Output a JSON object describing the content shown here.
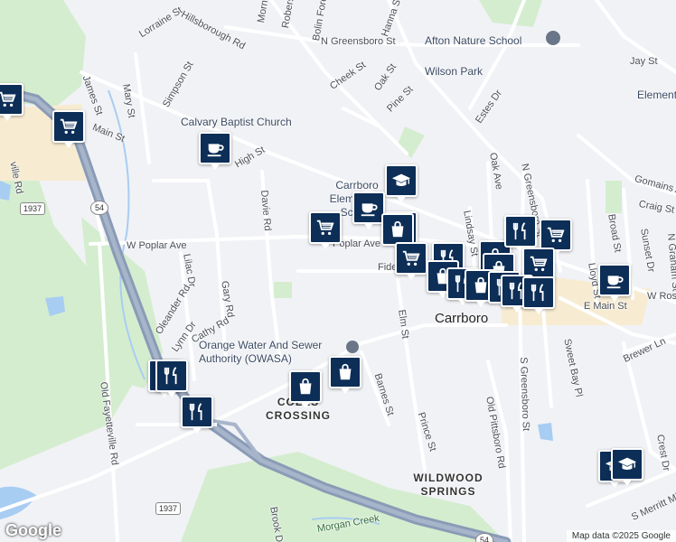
{
  "map": {
    "attribution": "Map data ©2025 Google",
    "logo_text": "Google",
    "colors": {
      "road": "#ffffff",
      "highway": "#8a9bb6",
      "park": "#d4edcf",
      "water": "#a8cdf2",
      "land": "#f1f2f6",
      "commercial": "#f7ecd2",
      "pin": "#0c2e57"
    },
    "streets": [
      "Lorraine St",
      "Hillsborough Rd",
      "Morningside Dr",
      "Roberson St",
      "Bolin Forest",
      "Hanna St",
      "N Greensboro St",
      "Oak St",
      "Cheek St",
      "Simpson St",
      "Mary St",
      "James St",
      "Main St",
      "High St",
      "Pine St",
      "Estes Dr",
      "Jay St",
      "Oak Ave",
      "N Greensboro St",
      "Gomains Ave",
      "Craig St",
      "Broad St",
      "Lindsay St",
      "W Poplar Ave",
      "Poplar Ave",
      "Fidelity St",
      "Davie Rd",
      "Lilac Dr",
      "Oleander Rd",
      "Gary Rd",
      "Cathy Rd",
      "Lynn Dr",
      "Old Fayetteville Rd",
      "Elm St",
      "Barnes St",
      "Prince St",
      "Old Pittsboro Rd",
      "S Greensboro St",
      "Sweet Bay Pl",
      "Brewer Ln",
      "E Main St",
      "W Rosemary St",
      "Lloyd St",
      "Sunset Dr",
      "N Graham St",
      "Crest Dr",
      "S Merritt Mill Rd",
      "Morgan Creek",
      "Brook Dr",
      "ville Rd"
    ],
    "places": [
      "Afton Nature School",
      "Wilson Park",
      "Calvary Baptist Church",
      "Carrboro Elementary School",
      "Orange Water And Sewer Authority (OWASA)",
      "Elementary"
    ],
    "towns": [
      "Carrboro"
    ],
    "neighborhoods": [
      "COLES CROSSING",
      "WILDWOOD SPRINGS"
    ],
    "route_shields": [
      "1937",
      "54",
      "1937",
      "54"
    ],
    "markers": [
      {
        "icon": "shopping-cart-icon"
      },
      {
        "icon": "shopping-cart-icon"
      },
      {
        "icon": "coffee-cup-icon"
      },
      {
        "icon": "graduation-cap-icon"
      },
      {
        "icon": "coffee-cup-icon"
      },
      {
        "icon": "shopping-cart-icon"
      },
      {
        "icon": "shopping-bag-icon"
      },
      {
        "icon": "shopping-bag-icon"
      },
      {
        "icon": "shopping-cart-icon"
      },
      {
        "icon": "fork-knife-icon"
      },
      {
        "icon": "shopping-bag-icon"
      },
      {
        "icon": "fork-knife-icon"
      },
      {
        "icon": "shopping-cart-icon"
      },
      {
        "icon": "shopping-bag-icon"
      },
      {
        "icon": "shopping-cart-icon"
      },
      {
        "icon": "shopping-bag-icon"
      },
      {
        "icon": "fork-knife-icon"
      },
      {
        "icon": "shopping-bag-icon"
      },
      {
        "icon": "fork-knife-icon"
      },
      {
        "icon": "fork-knife-icon"
      },
      {
        "icon": "fork-knife-icon"
      },
      {
        "icon": "coffee-cup-icon"
      },
      {
        "icon": "fork-knife-icon"
      },
      {
        "icon": "fork-knife-icon"
      },
      {
        "icon": "shopping-bag-icon"
      },
      {
        "icon": "shopping-bag-icon"
      },
      {
        "icon": "fork-knife-icon"
      },
      {
        "icon": "graduation-cap-icon"
      },
      {
        "icon": "graduation-cap-icon"
      }
    ]
  }
}
